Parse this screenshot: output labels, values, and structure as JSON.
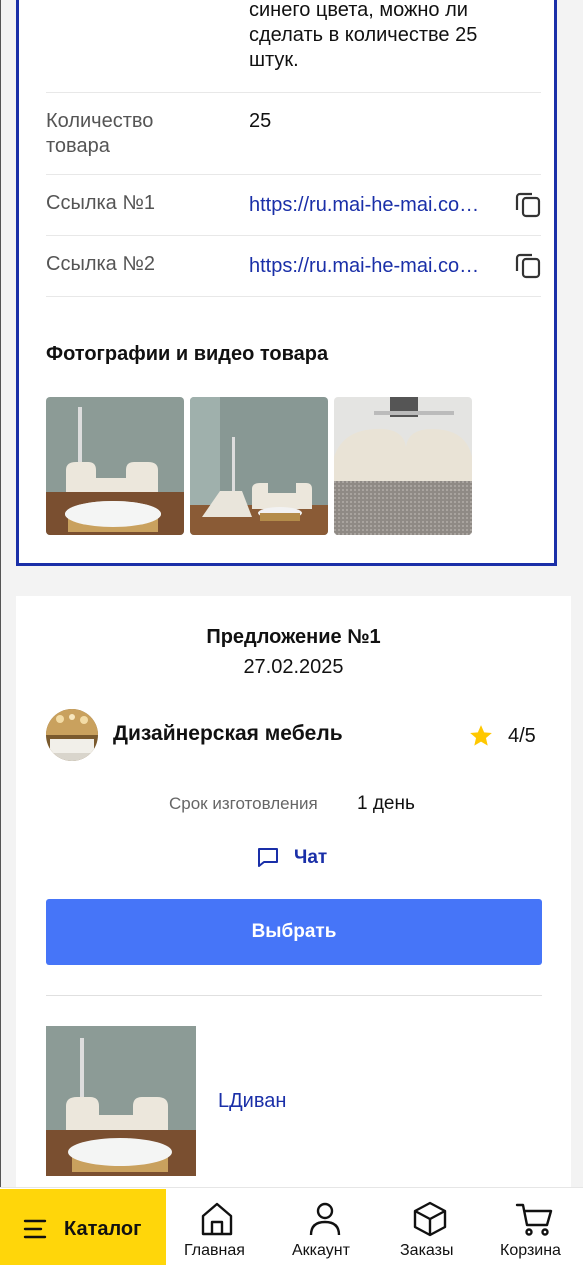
{
  "request": {
    "description": "синего цвета, можно ли сделать в количестве 25 штук.",
    "rows": [
      {
        "label": "Количество товара",
        "value": "25"
      },
      {
        "label": "Ссылка №1",
        "value": "https://ru.mai-he-mai.com/product"
      },
      {
        "label": "Ссылка №2",
        "value": "https://ru.mai-he-mai.com/product"
      }
    ],
    "media_title": "Фотографии и видео товара"
  },
  "offer": {
    "title": "Предложение №1",
    "date": "27.02.2025",
    "seller": "Дизайнерская мебель",
    "rating": "4/5",
    "lead_time_label": "Срок изготовления",
    "lead_time_value": "1 день",
    "chat_label": "Чат",
    "choose_label": "Выбрать",
    "product_name": "LДиван"
  },
  "nav": {
    "catalog": "Каталог",
    "items": [
      "Главная",
      "Аккаунт",
      "Заказы",
      "Корзина"
    ]
  },
  "colors": {
    "brand_blue": "#1a2fa8",
    "button_blue": "#4675f8",
    "catalog_yellow": "#ffd60a",
    "star_yellow": "#ffc800"
  },
  "icons": [
    "copy-icon",
    "star-icon",
    "chat-icon",
    "menu-icon",
    "home-icon",
    "user-icon",
    "box-icon",
    "cart-icon"
  ]
}
